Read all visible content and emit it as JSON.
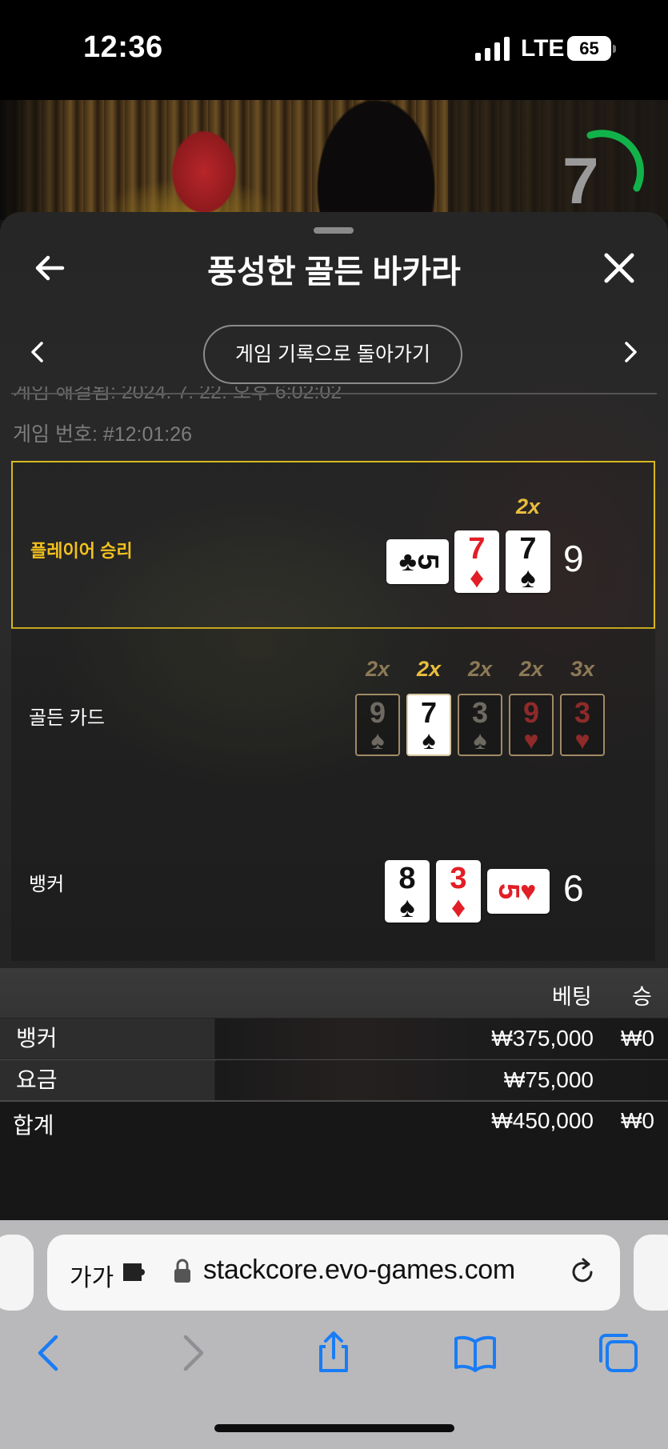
{
  "status_bar": {
    "time": "12:36",
    "network": "LTE",
    "battery": "65"
  },
  "video": {
    "timer": "7"
  },
  "header": {
    "title": "풍성한 골든 바카라"
  },
  "nav": {
    "back_to_history": "게임 기록으로 돌아가기"
  },
  "meta": {
    "game_datetime_partial": "게임 해결됨: 2024. 7. 22. 오후 6:02:02",
    "game_number": "게임 번호: #12:01:26"
  },
  "results": {
    "player": {
      "label": "플레이어 승리",
      "score": "9",
      "cards": [
        {
          "rank": "5",
          "suit": "♣",
          "color": "#111111",
          "orientation": "sideways"
        },
        {
          "rank": "7",
          "suit": "♦",
          "color": "#e21e26"
        },
        {
          "rank": "7",
          "suit": "♠",
          "color": "#111111",
          "multiplier": "2x"
        }
      ]
    },
    "golden": {
      "label": "골든 카드",
      "cards": [
        {
          "rank": "9",
          "suit": "♠",
          "multiplier": "2x",
          "highlighted": false
        },
        {
          "rank": "7",
          "suit": "♠",
          "multiplier": "2x",
          "highlighted": true
        },
        {
          "rank": "3",
          "suit": "♠",
          "multiplier": "2x",
          "highlighted": false
        },
        {
          "rank": "9",
          "suit": "♥",
          "multiplier": "2x",
          "highlighted": false
        },
        {
          "rank": "3",
          "suit": "♥",
          "multiplier": "3x",
          "highlighted": false
        }
      ]
    },
    "banker": {
      "label": "뱅커",
      "score": "6",
      "cards": [
        {
          "rank": "8",
          "suit": "♠",
          "color": "#111111"
        },
        {
          "rank": "3",
          "suit": "♦",
          "color": "#e21e26"
        },
        {
          "rank": "5",
          "suit": "♥",
          "color": "#e21e26",
          "orientation": "sideways"
        }
      ]
    }
  },
  "bets": {
    "columns": {
      "bet": "베팅",
      "win": "승"
    },
    "rows": [
      {
        "name": "뱅커",
        "bet": "₩375,000",
        "win": "₩0"
      },
      {
        "name": "요금",
        "bet": "₩75,000",
        "win": ""
      }
    ],
    "total": {
      "name": "합계",
      "bet": "₩450,000",
      "win": "₩0"
    }
  },
  "browser": {
    "aa_label": "가가",
    "url": "stackcore.evo-games.com"
  },
  "colors": {
    "winner_border": "#d8b820",
    "winner_text": "#f2c11e",
    "multiplier_gold": "#e8bd3c",
    "card_red": "#e21e26",
    "ios_blue": "#1a7cf5",
    "timer_green": "#12b24a"
  },
  "icons": {
    "back": "arrow-left-icon",
    "close": "close-icon",
    "prev": "chevron-left-icon",
    "next": "chevron-right-icon",
    "lock": "lock-icon",
    "extension": "extension-icon",
    "reload": "reload-icon",
    "share": "share-icon",
    "bookmarks": "bookmarks-icon",
    "tabs": "tabs-icon"
  }
}
